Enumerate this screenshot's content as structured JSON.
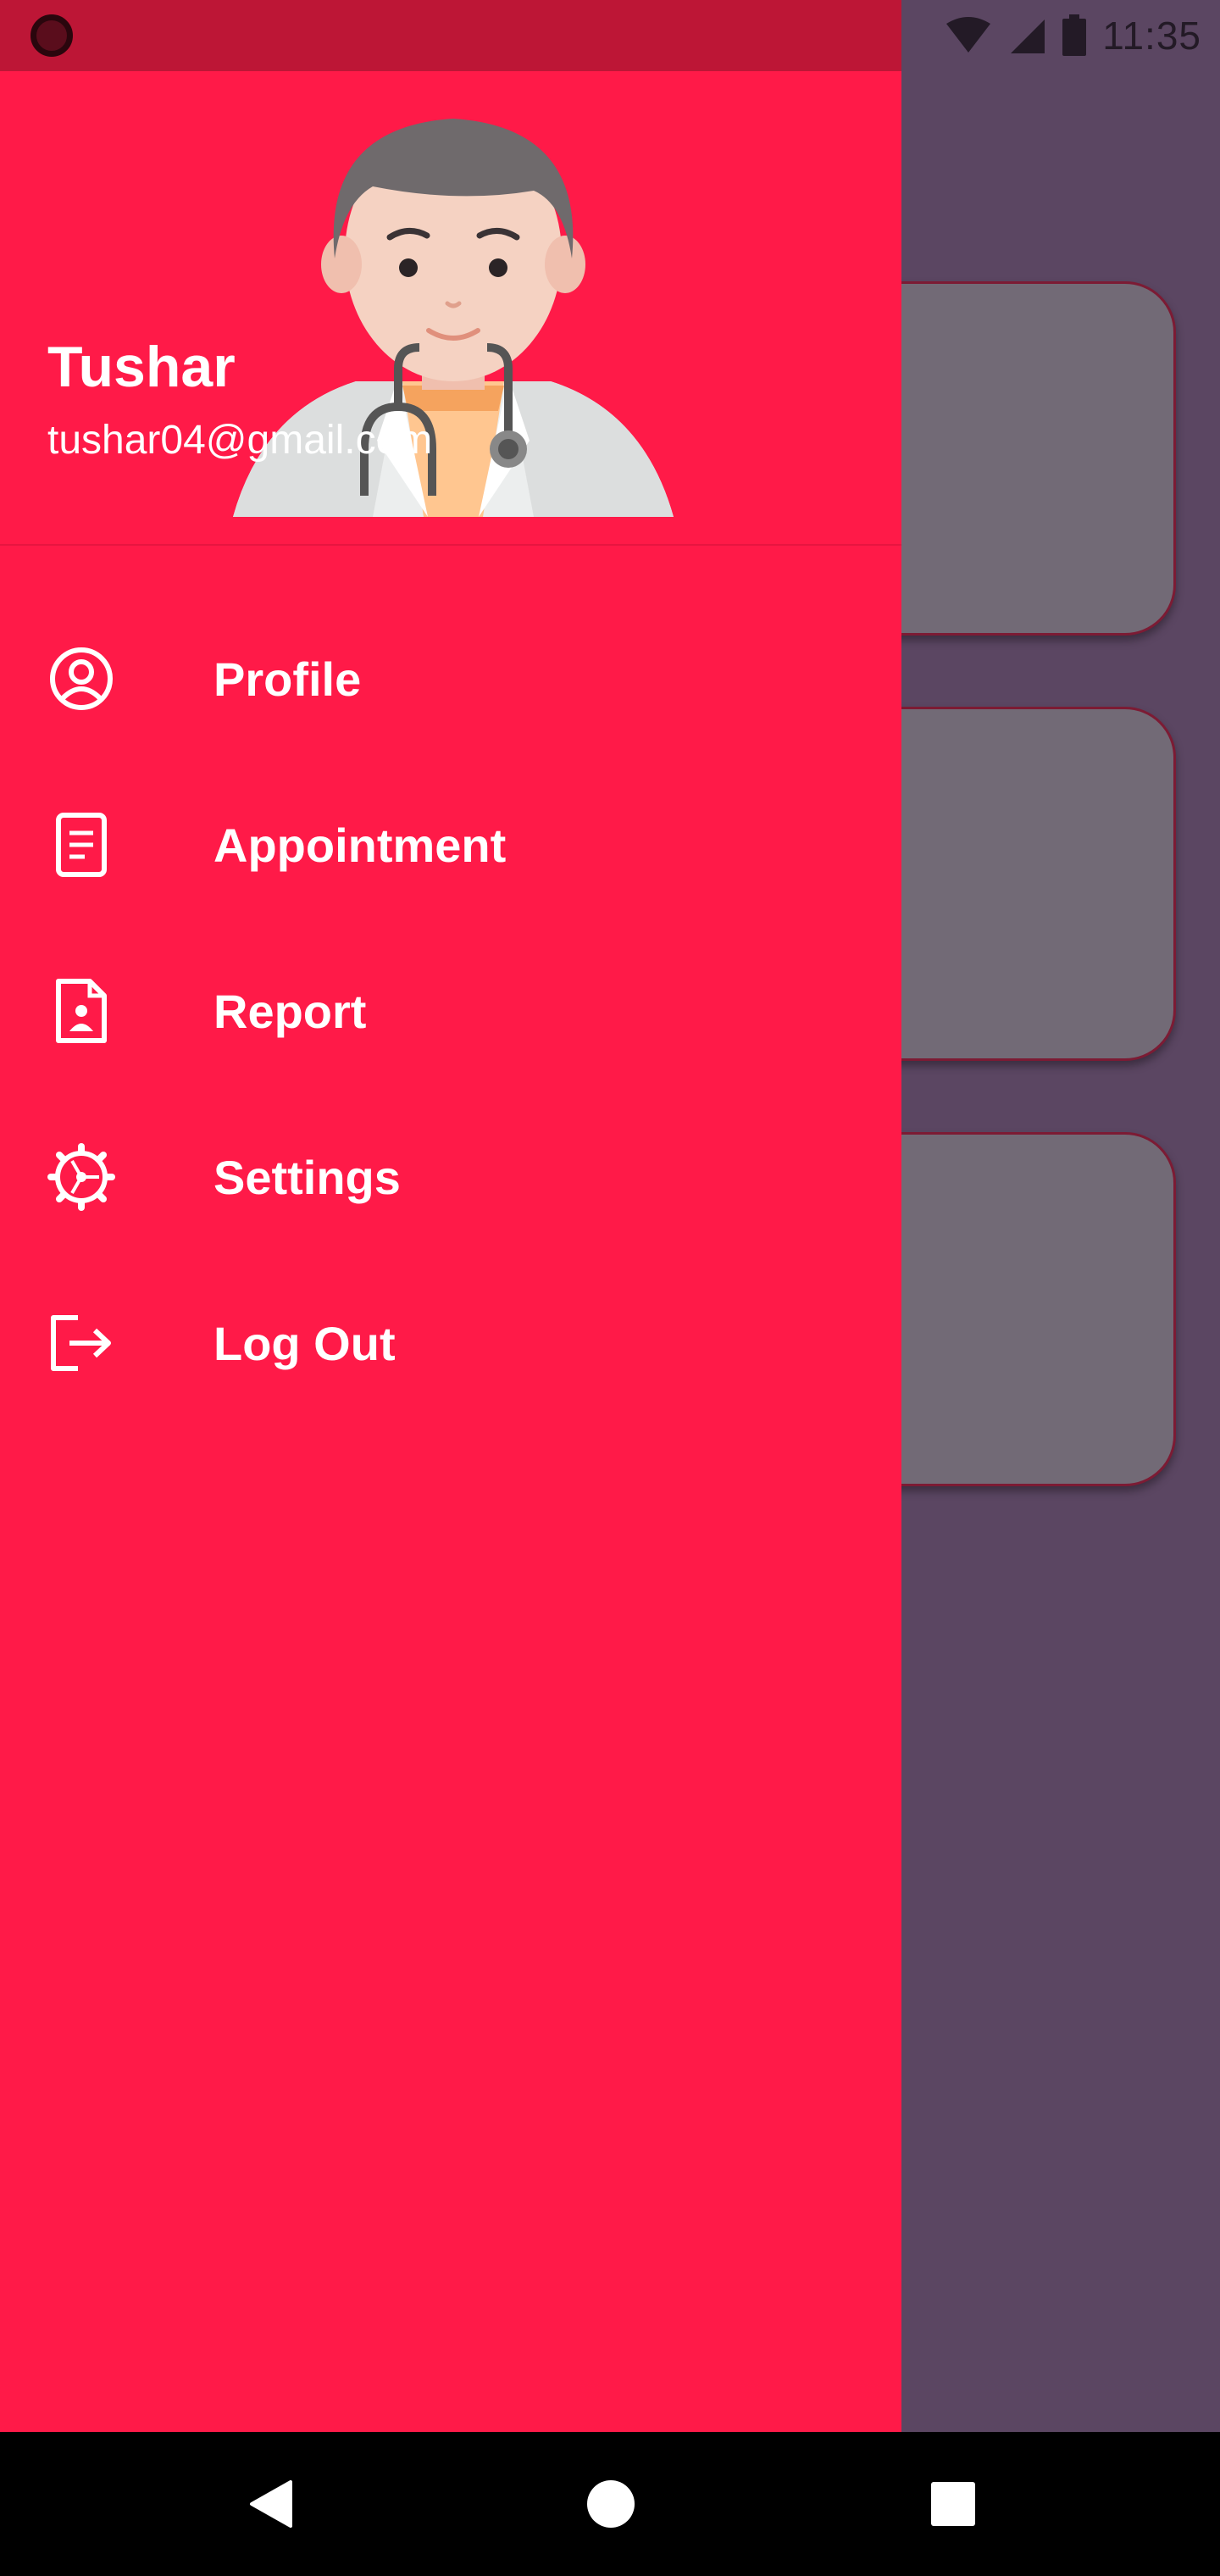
{
  "status_bar": {
    "time": "11:35",
    "icons": [
      "recording-icon",
      "wifi-icon",
      "signal-icon",
      "battery-icon"
    ]
  },
  "drawer": {
    "user": {
      "name": "Tushar",
      "email": "tushar04@gmail.com",
      "avatar": "doctor-avatar"
    },
    "menu": [
      {
        "label": "Profile",
        "icon": "profile-icon"
      },
      {
        "label": "Appointment",
        "icon": "appointment-icon"
      },
      {
        "label": "Report",
        "icon": "report-icon"
      },
      {
        "label": "Settings",
        "icon": "settings-icon"
      },
      {
        "label": "Log Out",
        "icon": "logout-icon"
      }
    ]
  },
  "nav_bar": {
    "icons": [
      "back-icon",
      "home-icon",
      "recents-icon"
    ]
  },
  "colors": {
    "drawer_bg": "#ff1a48",
    "status_bar_bg": "#bd1636",
    "scrim": "#5b4662",
    "text": "#ffffff"
  }
}
